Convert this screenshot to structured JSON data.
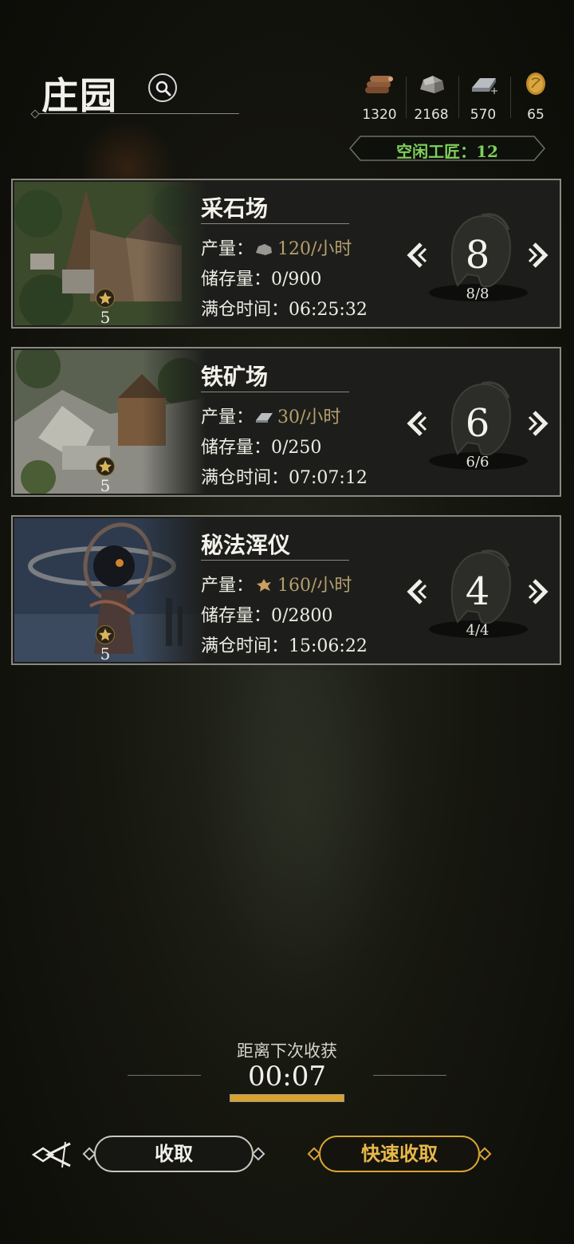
{
  "header": {
    "title": "庄园"
  },
  "resources": [
    {
      "icon": "wood-icon",
      "value": "1320"
    },
    {
      "icon": "stone-icon",
      "value": "2168"
    },
    {
      "icon": "iron-icon",
      "value": "570"
    },
    {
      "icon": "gold-coin-icon",
      "value": "65"
    }
  ],
  "idle_craftsmen": "空闲工匠：12",
  "buildings": [
    {
      "name": "采石场",
      "level": "5",
      "production_label": "产量：",
      "production_rate": "120/小时",
      "production_icon": "stone-icon",
      "storage_label": "储存量：",
      "storage_value": "0/900",
      "full_label": "满仓时间：",
      "full_time": "06:25:32",
      "workers": "8",
      "workers_fraction": "8/8"
    },
    {
      "name": "铁矿场",
      "level": "5",
      "production_label": "产量：",
      "production_rate": "30/小时",
      "production_icon": "iron-icon",
      "storage_label": "储存量：",
      "storage_value": "0/250",
      "full_label": "满仓时间：",
      "full_time": "07:07:12",
      "workers": "6",
      "workers_fraction": "6/6"
    },
    {
      "name": "秘法浑仪",
      "level": "5",
      "production_label": "产量：",
      "production_rate": "160/小时",
      "production_icon": "arcane-crystal-icon",
      "storage_label": "储存量：",
      "storage_value": "0/2800",
      "full_label": "满仓时间：",
      "full_time": "15:06:22",
      "workers": "4",
      "workers_fraction": "4/4"
    }
  ],
  "harvest": {
    "label": "距离下次收获",
    "countdown": "00:07",
    "progress": 1.0
  },
  "buttons": {
    "collect": "收取",
    "quick_collect": "快速收取"
  },
  "colors": {
    "accent_gold": "#d8a631",
    "idle_green": "#7ed05a",
    "rate_tan": "#b69f6d"
  }
}
